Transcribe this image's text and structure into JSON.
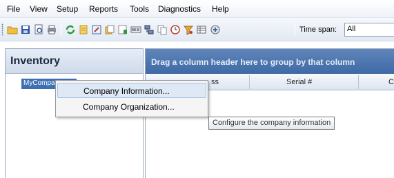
{
  "menu": [
    "File",
    "View",
    "Setup",
    "Reports",
    "Tools",
    "Diagnostics",
    "Help"
  ],
  "toolbar": {
    "icons": [
      "open-folder-icon",
      "save-icon",
      "print-preview-icon",
      "print-icon",
      "refresh-icon",
      "notes-icon",
      "edit-icon",
      "documents-icon",
      "report-icon",
      "serial-icon",
      "network-icon",
      "copy-icon",
      "clock-icon",
      "filter-icon",
      "table-icon",
      "tool-icon"
    ],
    "time_span_label": "Time span:",
    "time_span_value": "All"
  },
  "left": {
    "title": "Inventory",
    "tree_node": "MyCompany"
  },
  "right": {
    "group_hint": "Drag a column header here to group by that column",
    "columns": [
      "ss",
      "Serial #",
      "C"
    ]
  },
  "context_menu": {
    "items": [
      "Company Information...",
      "Company Organization..."
    ]
  },
  "tooltip": "Configure the company information",
  "colors": {
    "accent": "#3f6aa6",
    "tree_selection": "#3d6fb2",
    "menu_highlight": "#dfe9f6"
  }
}
